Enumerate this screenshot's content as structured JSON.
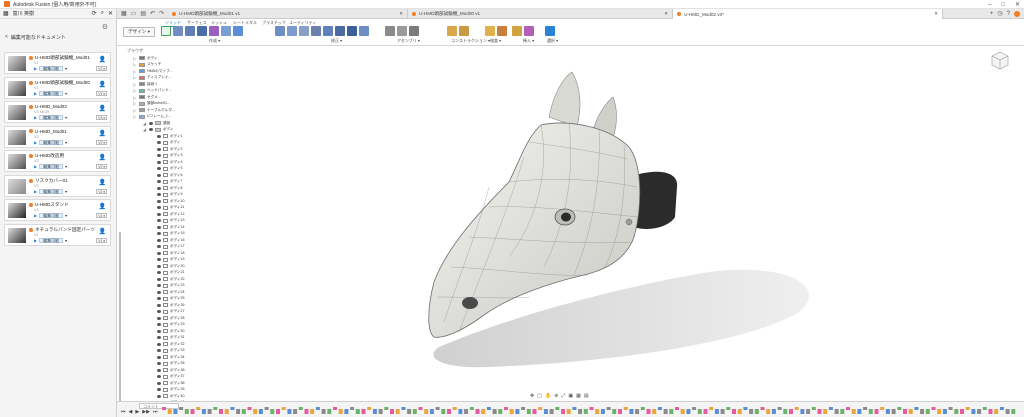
{
  "window": {
    "title": "Autodesk Fusion (個人用/商用外不可)",
    "controls": [
      "–",
      "□",
      "✕"
    ]
  },
  "data_panel": {
    "team_label": "富川 英樹",
    "breadcrumb": "<",
    "breadcrumb_title": "編集可能なドキュメント",
    "items": [
      {
        "name": "U-HMD頭部試験機_Mod01",
        "version": "V1",
        "status": "編集可能",
        "vtag": "V1 ▾",
        "thumb_color": "#5a5a5a"
      },
      {
        "name": "U-HMD頭部試験機_Mod00",
        "version": "V1",
        "status": "編集可能",
        "vtag": "V1 ▾",
        "thumb_color": "#3d3d3d"
      },
      {
        "name": "U-HMD_Mod02",
        "version": "V3  18:39",
        "status": "編集可能",
        "vtag": "V3 ▾",
        "thumb_color": "#4a4a4a"
      },
      {
        "name": "U-HMD_Mod01",
        "version": "V2",
        "status": "編集可能",
        "vtag": "V2 ▾",
        "thumb_color": "#555"
      },
      {
        "name": "U-HMD改造用",
        "version": "V2",
        "status": "編集可能",
        "vtag": "V2 ▾",
        "thumb_color": "#4f4f4f"
      },
      {
        "name": "リスクカバー01",
        "version": "V2",
        "status": "編集可能",
        "vtag": "V2 ▾",
        "thumb_color": "#888"
      },
      {
        "name": "U-HMDスタンド",
        "version": "V1",
        "status": "編集可能",
        "vtag": "V1 ▾",
        "thumb_color": "#222"
      },
      {
        "name": "ネチュラルバンド固定パーツ",
        "version": "V1",
        "status": "編集可能",
        "vtag": "V1 ▾",
        "thumb_color": "#333"
      }
    ]
  },
  "tabs": [
    {
      "label": "U-HMD頭部試験機_Mod01 v1",
      "active": false
    },
    {
      "label": "U-HMD頭部試験機_Mod00 v1",
      "active": false
    },
    {
      "label": "U-HMD_Mod02 v3*",
      "active": true
    }
  ],
  "ribbon": {
    "workspace": "デザイン ▾",
    "tabs": [
      "ソリッド",
      "サーフェス",
      "メッシュ",
      "シートメタル",
      "プラスチック",
      "ユーティリティ"
    ],
    "groups": [
      "作成 ▾",
      "修正 ▾",
      "アセンブリ ▾",
      "コンストラクション ▾",
      "検査 ▾",
      "挿入 ▾",
      "選択 ▾"
    ]
  },
  "browser": {
    "header": "ブラウザ",
    "rows": [
      "ボディ",
      "スケッチ",
      "HMDのマップ...",
      "ディスプレイ...",
      "接続 1",
      "ヘッドバンド...",
      "セグメ...",
      "頭部mesh01...",
      "ケーブルホルダ...",
      "Uフレーム_1...",
      "頭部",
      "ボディ",
      "ボディ1",
      "ボディ",
      "ボディ2",
      "ボディ3",
      "ボディ4",
      "ボディ5",
      "ボディ6",
      "ボディ7",
      "ボディ8",
      "ボディ9",
      "ボディ10",
      "ボディ11",
      "ボディ12",
      "ボディ13",
      "ボディ14",
      "ボディ15",
      "ボディ16",
      "ボディ17",
      "ボディ18",
      "ボディ19",
      "ボディ20",
      "ボディ21",
      "ボディ22",
      "ボディ23",
      "ボディ24",
      "ボディ25",
      "ボディ26",
      "ボディ27",
      "ボディ28",
      "ボディ29",
      "ボディ30",
      "ボディ31",
      "ボディ32",
      "ボディ33",
      "ボディ34",
      "ボディ35",
      "ボディ36",
      "ボディ37",
      "ボディ38",
      "ボディ39",
      "ボディ40",
      "ボディ41"
    ]
  },
  "viewcube": {
    "label": ""
  },
  "timeline": {
    "comment_label": "コメント"
  }
}
